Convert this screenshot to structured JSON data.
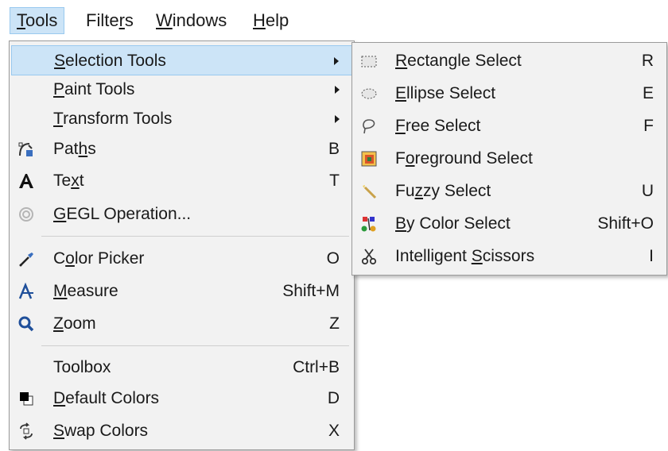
{
  "menubar": {
    "items": [
      {
        "pre": "",
        "key": "T",
        "post": "ools"
      },
      {
        "pre": "Filte",
        "key": "r",
        "post": "s"
      },
      {
        "pre": "",
        "key": "W",
        "post": "indows"
      },
      {
        "pre": "",
        "key": "H",
        "post": "elp"
      }
    ]
  },
  "tools_menu": {
    "items": [
      {
        "pre": "",
        "key": "S",
        "post": "election Tools",
        "shortcut": "",
        "icon": "none"
      },
      {
        "pre": "",
        "key": "P",
        "post": "aint Tools",
        "shortcut": "",
        "icon": "none"
      },
      {
        "pre": "",
        "key": "T",
        "post": "ransform Tools",
        "shortcut": "",
        "icon": "none"
      },
      {
        "pre": "Pat",
        "key": "h",
        "post": "s",
        "shortcut": "B",
        "icon": "paths-icon"
      },
      {
        "pre": "Te",
        "key": "x",
        "post": "t",
        "shortcut": "T",
        "icon": "text-icon"
      },
      {
        "pre": "",
        "key": "G",
        "post": "EGL Operation...",
        "shortcut": "",
        "icon": "gegl-icon"
      },
      {
        "pre": "C",
        "key": "o",
        "post": "lor Picker",
        "shortcut": "O",
        "icon": "color-picker-icon"
      },
      {
        "pre": "",
        "key": "M",
        "post": "easure",
        "shortcut": "Shift+M",
        "icon": "measure-icon"
      },
      {
        "pre": "",
        "key": "Z",
        "post": "oom",
        "shortcut": "Z",
        "icon": "zoom-icon"
      },
      {
        "pre": "Toolbox",
        "key": "",
        "post": "",
        "shortcut": "Ctrl+B",
        "icon": "none"
      },
      {
        "pre": "",
        "key": "D",
        "post": "efault Colors",
        "shortcut": "D",
        "icon": "default-colors-icon"
      },
      {
        "pre": "",
        "key": "S",
        "post": "wap Colors",
        "shortcut": "X",
        "icon": "swap-colors-icon"
      }
    ]
  },
  "selection_menu": {
    "items": [
      {
        "pre": "",
        "key": "R",
        "post": "ectangle Select",
        "shortcut": "R",
        "icon": "rectangle-select-icon"
      },
      {
        "pre": "",
        "key": "E",
        "post": "llipse Select",
        "shortcut": "E",
        "icon": "ellipse-select-icon"
      },
      {
        "pre": "",
        "key": "F",
        "post": "ree Select",
        "shortcut": "F",
        "icon": "free-select-icon"
      },
      {
        "pre": "F",
        "key": "o",
        "post": "reground Select",
        "shortcut": "",
        "icon": "foreground-select-icon"
      },
      {
        "pre": "Fu",
        "key": "z",
        "post": "zy Select",
        "shortcut": "U",
        "icon": "fuzzy-select-icon"
      },
      {
        "pre": "",
        "key": "B",
        "post": "y Color Select",
        "shortcut": "Shift+O",
        "icon": "by-color-select-icon"
      },
      {
        "pre": "Intelligent ",
        "key": "S",
        "post": "cissors",
        "shortcut": "I",
        "icon": "intelligent-scissors-icon"
      }
    ]
  },
  "colors": {
    "highlight": "#cce4f7",
    "highlight_border": "#99c9ef",
    "menu_bg": "#f2f2f2"
  }
}
